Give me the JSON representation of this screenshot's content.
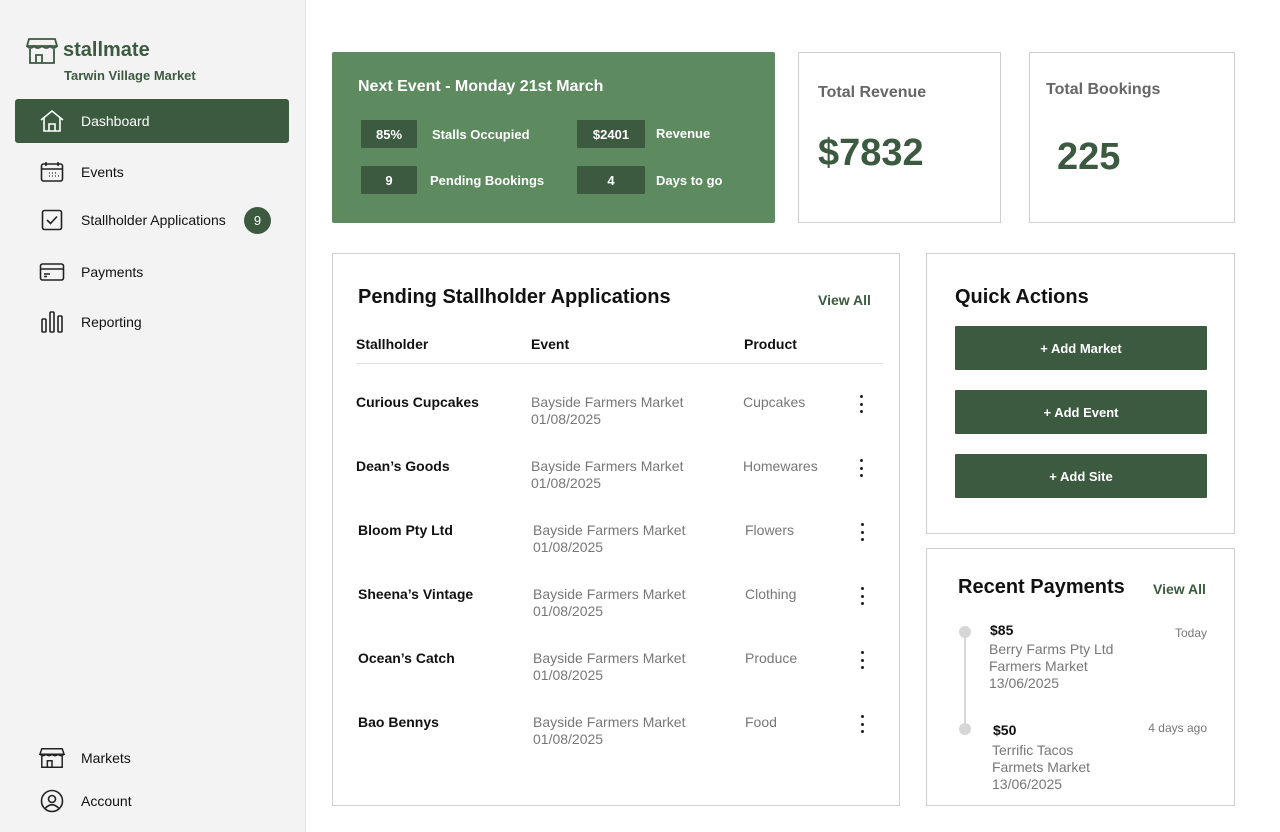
{
  "brand": {
    "name": "stallmate",
    "market": "Tarwin Village Market"
  },
  "nav": {
    "items": [
      {
        "label": "Dashboard",
        "icon": "home-icon",
        "active": true
      },
      {
        "label": "Events",
        "icon": "calendar-icon"
      },
      {
        "label": "Stallholder Applications",
        "icon": "checkbox-icon",
        "badge": "9"
      },
      {
        "label": "Payments",
        "icon": "credit-card-icon"
      },
      {
        "label": "Reporting",
        "icon": "bar-chart-icon"
      }
    ],
    "bottom": [
      {
        "label": "Markets",
        "icon": "store-icon"
      },
      {
        "label": "Account",
        "icon": "user-circle-icon"
      }
    ]
  },
  "next_event": {
    "title": "Next Event - Monday 21st March",
    "stats": [
      {
        "value": "85%",
        "label": "Stalls Occupied"
      },
      {
        "value": "$2401",
        "label": "Revenue"
      },
      {
        "value": "9",
        "label": "Pending Bookings"
      },
      {
        "value": "4",
        "label": "Days to go"
      }
    ]
  },
  "kpis": {
    "revenue": {
      "label": "Total Revenue",
      "value": "$7832"
    },
    "bookings": {
      "label": "Total Bookings",
      "value": "225"
    }
  },
  "applications": {
    "title": "Pending Stallholder Applications",
    "view_all": "View All",
    "columns": [
      "Stallholder",
      "Event",
      "Product"
    ],
    "rows": [
      {
        "name": "Curious Cupcakes",
        "event": "Bayside Farmers Market",
        "date": "01/08/2025",
        "product": "Cupcakes"
      },
      {
        "name": "Dean’s Goods",
        "event": "Bayside Farmers Market",
        "date": "01/08/2025",
        "product": "Homewares"
      },
      {
        "name": "Bloom Pty Ltd",
        "event": "Bayside Farmers Market",
        "date": "01/08/2025",
        "product": "Flowers"
      },
      {
        "name": "Sheena’s Vintage",
        "event": "Bayside Farmers Market",
        "date": "01/08/2025",
        "product": "Clothing"
      },
      {
        "name": "Ocean’s Catch",
        "event": "Bayside Farmers Market",
        "date": "01/08/2025",
        "product": "Produce"
      },
      {
        "name": "Bao Bennys",
        "event": "Bayside Farmers Market",
        "date": "01/08/2025",
        "product": "Food"
      }
    ]
  },
  "quick_actions": {
    "title": "Quick Actions",
    "buttons": [
      "+ Add Market",
      "+ Add Event",
      "+ Add Site"
    ]
  },
  "payments": {
    "title": "Recent Payments",
    "view_all": "View All",
    "items": [
      {
        "amount": "$85",
        "payer": "Berry Farms Pty Ltd",
        "market": "Farmers Market",
        "date": "13/06/2025",
        "when": "Today"
      },
      {
        "amount": "$50",
        "payer": "Terrific Tacos",
        "market": "Farmets Market",
        "date": "13/06/2025",
        "when": "4 days ago"
      }
    ]
  },
  "colors": {
    "accent": "#3b5a3f",
    "event_card": "#5e8a60",
    "sidebar": "#f3f3f3"
  }
}
